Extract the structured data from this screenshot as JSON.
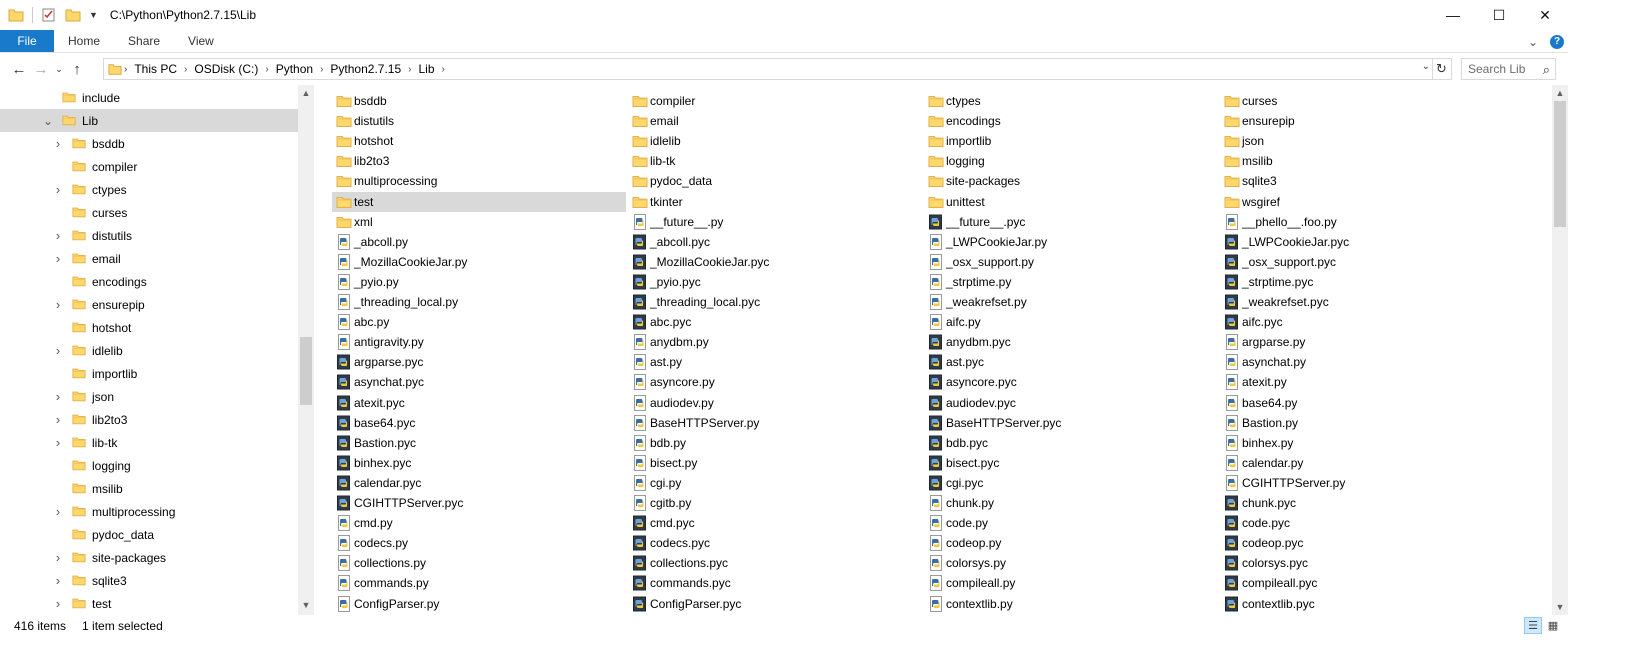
{
  "window": {
    "title": "C:\\Python\\Python2.7.15\\Lib",
    "controls": [
      "—",
      "☐",
      "✕"
    ]
  },
  "ribbon": {
    "tabs": [
      "File",
      "Home",
      "Share",
      "View"
    ]
  },
  "address": {
    "crumbs": [
      "This PC",
      "OSDisk (C:)",
      "Python",
      "Python2.7.15",
      "Lib"
    ],
    "search_placeholder": "Search Lib"
  },
  "tree": [
    {
      "label": "include",
      "level": 1,
      "expander": "",
      "selected": false
    },
    {
      "label": "Lib",
      "level": 1,
      "expander": "expanded",
      "selected": true
    },
    {
      "label": "bsddb",
      "level": 2,
      "expander": "collapsed",
      "selected": false
    },
    {
      "label": "compiler",
      "level": 2,
      "expander": "",
      "selected": false
    },
    {
      "label": "ctypes",
      "level": 2,
      "expander": "collapsed",
      "selected": false
    },
    {
      "label": "curses",
      "level": 2,
      "expander": "",
      "selected": false
    },
    {
      "label": "distutils",
      "level": 2,
      "expander": "collapsed",
      "selected": false
    },
    {
      "label": "email",
      "level": 2,
      "expander": "collapsed",
      "selected": false
    },
    {
      "label": "encodings",
      "level": 2,
      "expander": "",
      "selected": false
    },
    {
      "label": "ensurepip",
      "level": 2,
      "expander": "collapsed",
      "selected": false
    },
    {
      "label": "hotshot",
      "level": 2,
      "expander": "",
      "selected": false
    },
    {
      "label": "idlelib",
      "level": 2,
      "expander": "collapsed",
      "selected": false
    },
    {
      "label": "importlib",
      "level": 2,
      "expander": "",
      "selected": false
    },
    {
      "label": "json",
      "level": 2,
      "expander": "collapsed",
      "selected": false
    },
    {
      "label": "lib2to3",
      "level": 2,
      "expander": "collapsed",
      "selected": false
    },
    {
      "label": "lib-tk",
      "level": 2,
      "expander": "collapsed",
      "selected": false
    },
    {
      "label": "logging",
      "level": 2,
      "expander": "",
      "selected": false
    },
    {
      "label": "msilib",
      "level": 2,
      "expander": "",
      "selected": false
    },
    {
      "label": "multiprocessing",
      "level": 2,
      "expander": "collapsed",
      "selected": false
    },
    {
      "label": "pydoc_data",
      "level": 2,
      "expander": "",
      "selected": false
    },
    {
      "label": "site-packages",
      "level": 2,
      "expander": "collapsed",
      "selected": false
    },
    {
      "label": "sqlite3",
      "level": 2,
      "expander": "collapsed",
      "selected": false
    },
    {
      "label": "test",
      "level": 2,
      "expander": "collapsed",
      "selected": false
    }
  ],
  "files": [
    [
      "bsddb",
      "compiler",
      "ctypes",
      "curses"
    ],
    [
      "distutils",
      "email",
      "encodings",
      "ensurepip"
    ],
    [
      "hotshot",
      "idlelib",
      "importlib",
      "json"
    ],
    [
      "lib2to3",
      "lib-tk",
      "logging",
      "msilib"
    ],
    [
      "multiprocessing",
      "pydoc_data",
      "site-packages",
      "sqlite3"
    ],
    [
      "test",
      "tkinter",
      "unittest",
      "wsgiref"
    ],
    [
      "xml",
      "__future__.py",
      "__future__.pyc",
      "__phello__.foo.py"
    ],
    [
      "_abcoll.py",
      "_abcoll.pyc",
      "_LWPCookieJar.py",
      "_LWPCookieJar.pyc"
    ],
    [
      "_MozillaCookieJar.py",
      "_MozillaCookieJar.pyc",
      "_osx_support.py",
      "_osx_support.pyc"
    ],
    [
      "_pyio.py",
      "_pyio.pyc",
      "_strptime.py",
      "_strptime.pyc"
    ],
    [
      "_threading_local.py",
      "_threading_local.pyc",
      "_weakrefset.py",
      "_weakrefset.pyc"
    ],
    [
      "abc.py",
      "abc.pyc",
      "aifc.py",
      "aifc.pyc"
    ],
    [
      "antigravity.py",
      "anydbm.py",
      "anydbm.pyc",
      "argparse.py"
    ],
    [
      "argparse.pyc",
      "ast.py",
      "ast.pyc",
      "asynchat.py"
    ],
    [
      "asynchat.pyc",
      "asyncore.py",
      "asyncore.pyc",
      "atexit.py"
    ],
    [
      "atexit.pyc",
      "audiodev.py",
      "audiodev.pyc",
      "base64.py"
    ],
    [
      "base64.pyc",
      "BaseHTTPServer.py",
      "BaseHTTPServer.pyc",
      "Bastion.py"
    ],
    [
      "Bastion.pyc",
      "bdb.py",
      "bdb.pyc",
      "binhex.py"
    ],
    [
      "binhex.pyc",
      "bisect.py",
      "bisect.pyc",
      "calendar.py"
    ],
    [
      "calendar.pyc",
      "cgi.py",
      "cgi.pyc",
      "CGIHTTPServer.py"
    ],
    [
      "CGIHTTPServer.pyc",
      "cgitb.py",
      "chunk.py",
      "chunk.pyc"
    ],
    [
      "cmd.py",
      "cmd.pyc",
      "code.py",
      "code.pyc"
    ],
    [
      "codecs.py",
      "codecs.pyc",
      "codeop.py",
      "codeop.pyc"
    ],
    [
      "collections.py",
      "collections.pyc",
      "colorsys.py",
      "colorsys.pyc"
    ],
    [
      "commands.py",
      "commands.pyc",
      "compileall.py",
      "compileall.pyc"
    ],
    [
      "ConfigParser.py",
      "ConfigParser.pyc",
      "contextlib.py",
      "contextlib.pyc"
    ]
  ],
  "selected_file": "test",
  "status": {
    "count": "416 items",
    "selection": "1 item selected"
  },
  "colors": {
    "accent": "#1979ca",
    "folder": "#ffd76a",
    "folder_dark": "#e8b84a",
    "selection": "#d9d9d9"
  }
}
